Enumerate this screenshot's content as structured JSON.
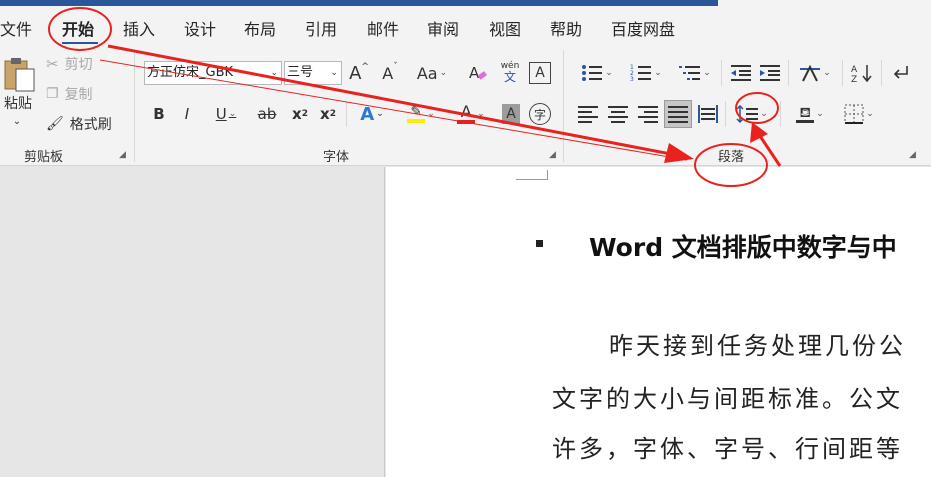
{
  "tabs": [
    "文件",
    "开始",
    "插入",
    "设计",
    "布局",
    "引用",
    "邮件",
    "审阅",
    "视图",
    "帮助",
    "百度网盘"
  ],
  "clipboard": {
    "paste": "粘贴",
    "cut": "剪切",
    "copy": "复制",
    "format_painter": "格式刷",
    "group_label": "剪贴板"
  },
  "font": {
    "font_name": "方正仿宋_GBK",
    "font_size": "三号",
    "grow": "A",
    "shrink": "A",
    "case": "Aa",
    "phonetic_top": "wén",
    "phonetic_bottom": "文",
    "border_char": "A",
    "bold": "B",
    "italic": "I",
    "underline": "U",
    "strike": "ab",
    "subscript": "x",
    "subscript_mark": "2",
    "superscript": "x",
    "superscript_mark": "2",
    "effects": "A",
    "highlight": "A",
    "font_color": "A",
    "shading_char": "A",
    "enclose_char": "字",
    "group_label": "字体"
  },
  "paragraph": {
    "group_label": "段落"
  },
  "document": {
    "heading": "Word 文档排版中数字与中",
    "line1": "昨天接到任务处理几份公",
    "line2": "文字的大小与间距标准。公文",
    "line3": "许多，字体、字号、行间距等"
  },
  "colors": {
    "accent": "#2b579a",
    "annotation": "#e8231f",
    "highlight_yellow": "#ffeb00",
    "font_red": "#e81e1e"
  }
}
